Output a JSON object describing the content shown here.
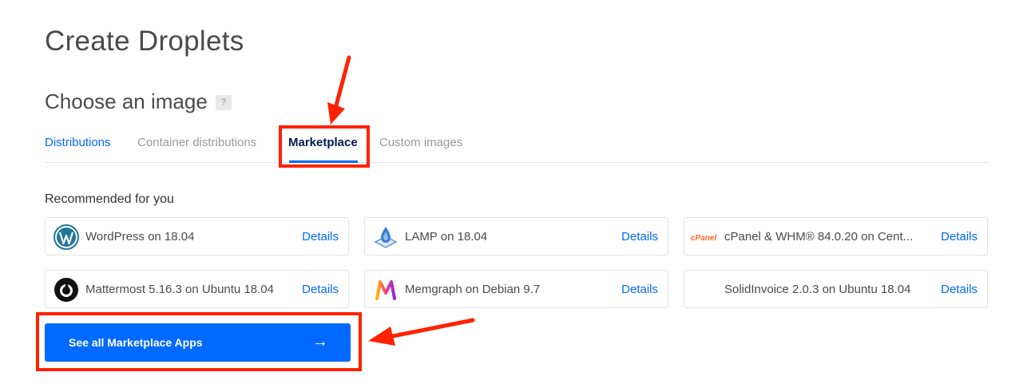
{
  "page": {
    "title": "Create Droplets"
  },
  "image_section": {
    "title": "Choose an image",
    "help_label": "?",
    "tabs": [
      {
        "label": "Distributions"
      },
      {
        "label": "Container distributions"
      },
      {
        "label": "Marketplace"
      },
      {
        "label": "Custom images"
      }
    ]
  },
  "recommended": {
    "title": "Recommended for you",
    "items": [
      {
        "name": "WordPress on 18.04",
        "details": "Details",
        "icon": "wordpress-icon"
      },
      {
        "name": "LAMP on 18.04",
        "details": "Details",
        "icon": "lamp-icon"
      },
      {
        "name": "cPanel & WHM® 84.0.20 on Cent...",
        "details": "Details",
        "icon": "cpanel-icon",
        "logo_text": "cPanel"
      },
      {
        "name": "Mattermost 5.16.3 on Ubuntu 18.04",
        "details": "Details",
        "icon": "mattermost-icon"
      },
      {
        "name": "Memgraph on Debian 9.7",
        "details": "Details",
        "icon": "memgraph-icon"
      },
      {
        "name": "SolidInvoice 2.0.3 on Ubuntu 18.04",
        "details": "Details",
        "icon": ""
      }
    ]
  },
  "cta": {
    "label": "See all Marketplace Apps",
    "arrow": "→"
  },
  "colors": {
    "accent": "#0069ff",
    "annotation": "#ff2200",
    "cpanel": "#ff6c2c"
  }
}
